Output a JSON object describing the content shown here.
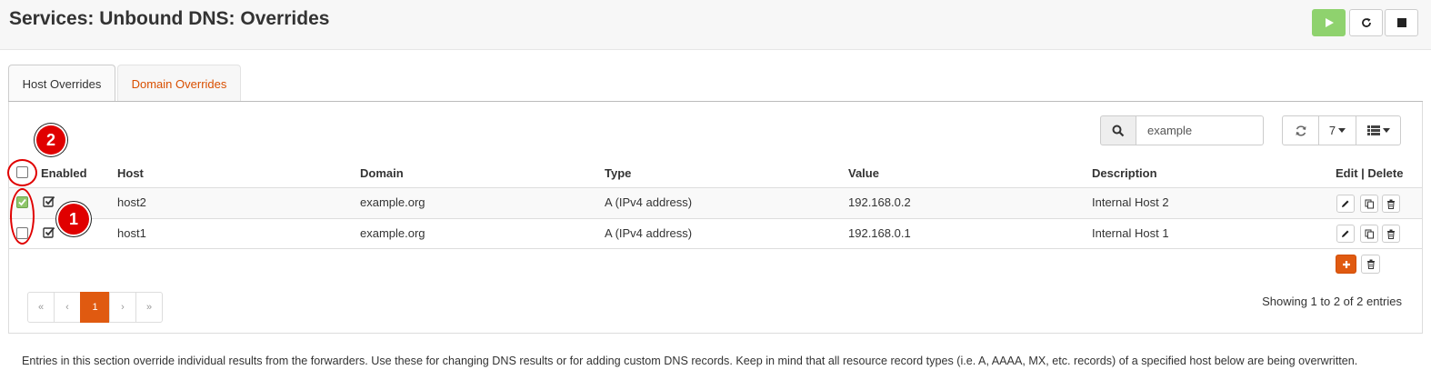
{
  "page": {
    "title": "Services: Unbound DNS: Overrides"
  },
  "header_buttons": [
    {
      "name": "play-icon"
    },
    {
      "name": "refresh-icon"
    },
    {
      "name": "stop-icon"
    }
  ],
  "tabs": [
    {
      "label": "Host Overrides",
      "active": true
    },
    {
      "label": "Domain Overrides",
      "active": false
    }
  ],
  "search": {
    "value": "example",
    "icon": "search-icon"
  },
  "toolbar": {
    "refresh_icon": "refresh-icon",
    "page_size": "7",
    "columns_icon": "list-icon"
  },
  "table": {
    "headers": {
      "enabled": "Enabled",
      "host": "Host",
      "domain": "Domain",
      "type": "Type",
      "value": "Value",
      "description": "Description",
      "actions": "Edit | Delete"
    },
    "rows": [
      {
        "selected": true,
        "enabled": true,
        "host": "host2",
        "domain": "example.org",
        "type": "A (IPv4 address)",
        "value": "192.168.0.2",
        "description": "Internal Host 2"
      },
      {
        "selected": false,
        "enabled": true,
        "host": "host1",
        "domain": "example.org",
        "type": "A (IPv4 address)",
        "value": "192.168.0.1",
        "description": "Internal Host 1"
      }
    ]
  },
  "pagination": {
    "first": "«",
    "prev": "‹",
    "current": "1",
    "next": "›",
    "last": "»"
  },
  "status": {
    "showing": "Showing 1 to 2 of 2 entries"
  },
  "footnote": "Entries in this section override individual results from the forwarders. Use these for changing DNS results or for adding custom DNS records. Keep in mind that all resource record types (i.e. A, AAAA, MX, etc. records) of a specified host below are being overwritten.",
  "annotations": {
    "marker_1": "1",
    "marker_2": "2"
  },
  "colors": {
    "accent": "#e05a10",
    "play": "#8fd26e",
    "annotation": "#e00000"
  }
}
